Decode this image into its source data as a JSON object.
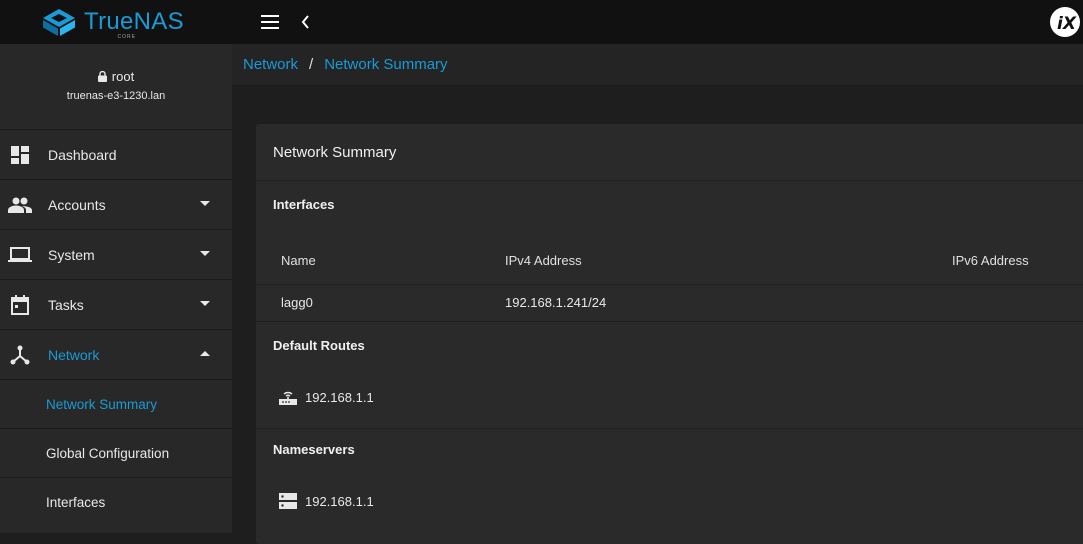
{
  "brand": {
    "name": "TrueNAS",
    "sub": "CORE"
  },
  "user": {
    "name": "root",
    "host": "truenas-e3-1230.lan"
  },
  "sidebar": {
    "items": [
      {
        "label": "Dashboard"
      },
      {
        "label": "Accounts"
      },
      {
        "label": "System"
      },
      {
        "label": "Tasks"
      },
      {
        "label": "Network"
      }
    ],
    "sub_items": [
      {
        "label": "Network Summary"
      },
      {
        "label": "Global Configuration"
      },
      {
        "label": "Interfaces"
      }
    ]
  },
  "breadcrumb": {
    "parent": "Network",
    "separator": "/",
    "current": "Network Summary"
  },
  "card": {
    "title": "Network Summary",
    "interfaces": {
      "title": "Interfaces",
      "columns": [
        "Name",
        "IPv4 Address",
        "IPv6 Address"
      ],
      "rows": [
        {
          "name": "lagg0",
          "ipv4": "192.168.1.241/24",
          "ipv6": ""
        }
      ]
    },
    "default_routes": {
      "title": "Default Routes",
      "items": [
        "192.168.1.1"
      ]
    },
    "nameservers": {
      "title": "Nameservers",
      "items": [
        "192.168.1.1"
      ]
    }
  },
  "colors": {
    "accent": "#1a9ad6",
    "background": "#1e1e1e",
    "sidebar": "#282828",
    "card": "#2a2a2a"
  }
}
